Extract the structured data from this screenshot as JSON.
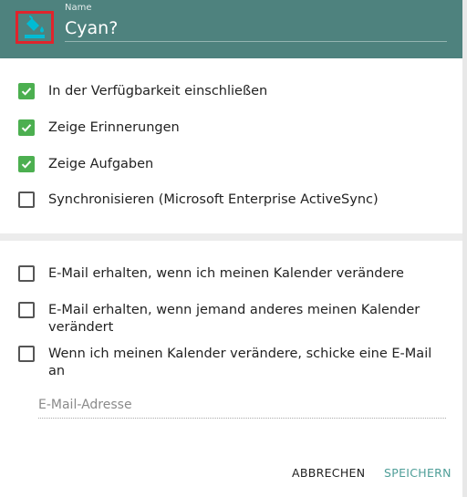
{
  "header": {
    "name_label": "Name",
    "name_value": "Cyan?",
    "icon": "paint-bucket-icon",
    "accent_color": "#00bcd4",
    "background_color": "#4e827e"
  },
  "options": [
    {
      "label": "In der Verfügbarkeit einschließen",
      "checked": true
    },
    {
      "label": "Zeige Erinnerungen",
      "checked": true
    },
    {
      "label": "Zeige Aufgaben",
      "checked": true
    },
    {
      "label": "Synchronisieren (Microsoft Enterprise ActiveSync)",
      "checked": false
    }
  ],
  "email_options": [
    {
      "label": "E-Mail erhalten, wenn ich meinen Kalender verändere",
      "checked": false
    },
    {
      "label": "E-Mail erhalten, wenn jemand anderes meinen Kalender verändert",
      "checked": false
    },
    {
      "label": "Wenn ich meinen Kalender verändere, schicke eine E-Mail an",
      "checked": false
    }
  ],
  "email_field": {
    "placeholder": "E-Mail-Adresse",
    "value": ""
  },
  "actions": {
    "cancel_label": "ABBRECHEN",
    "save_label": "SPEICHERN"
  }
}
